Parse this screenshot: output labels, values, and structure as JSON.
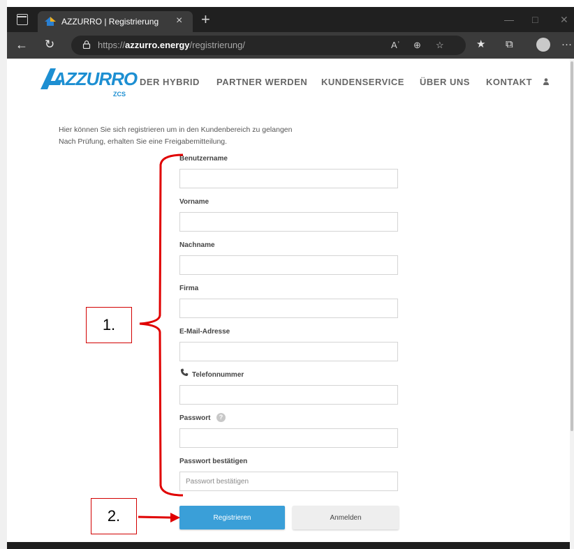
{
  "browser": {
    "tab_title": "AZZURRO | Registrierung",
    "tab_close": "×",
    "new_tab": "+",
    "url_prefix": "https://",
    "url_domain": "azzurro.energy",
    "url_path": "/registrierung/",
    "read_aloud": "Aʾ",
    "more_label": "···"
  },
  "site": {
    "logo_text": "AZZURRO",
    "logo_sub": "ZCS",
    "nav": [
      "DER HYBRID",
      "PARTNER WERDEN",
      "KUNDENSERVICE",
      "ÜBER UNS",
      "KONTAKT"
    ]
  },
  "intro": {
    "line1": "Hier können Sie sich registrieren um in den Kundenbereich zu gelangen",
    "line2": "Nach Prüfung, erhalten Sie eine Freigabemitteilung."
  },
  "form": {
    "fields": [
      {
        "label": "Benutzername",
        "value": "",
        "placeholder": ""
      },
      {
        "label": "Vorname",
        "value": "",
        "placeholder": ""
      },
      {
        "label": "Nachname",
        "value": "",
        "placeholder": ""
      },
      {
        "label": "Firma",
        "value": "",
        "placeholder": ""
      },
      {
        "label": "E-Mail-Adresse",
        "value": "",
        "placeholder": ""
      },
      {
        "label": "Telefonnummer",
        "value": "",
        "placeholder": ""
      },
      {
        "label": "Passwort",
        "value": "",
        "placeholder": ""
      },
      {
        "label": "Passwort bestätigen",
        "value": "",
        "placeholder": "Passwort bestätigen"
      }
    ],
    "help_glyph": "?",
    "register_label": "Registrieren",
    "login_label": "Anmelden"
  },
  "annotations": {
    "step1": "1.",
    "step2": "2.",
    "color": "#d20000"
  },
  "colors": {
    "accent": "#3a9fd8",
    "logo": "#1d8fd2",
    "footer": "#1e1e1e"
  }
}
